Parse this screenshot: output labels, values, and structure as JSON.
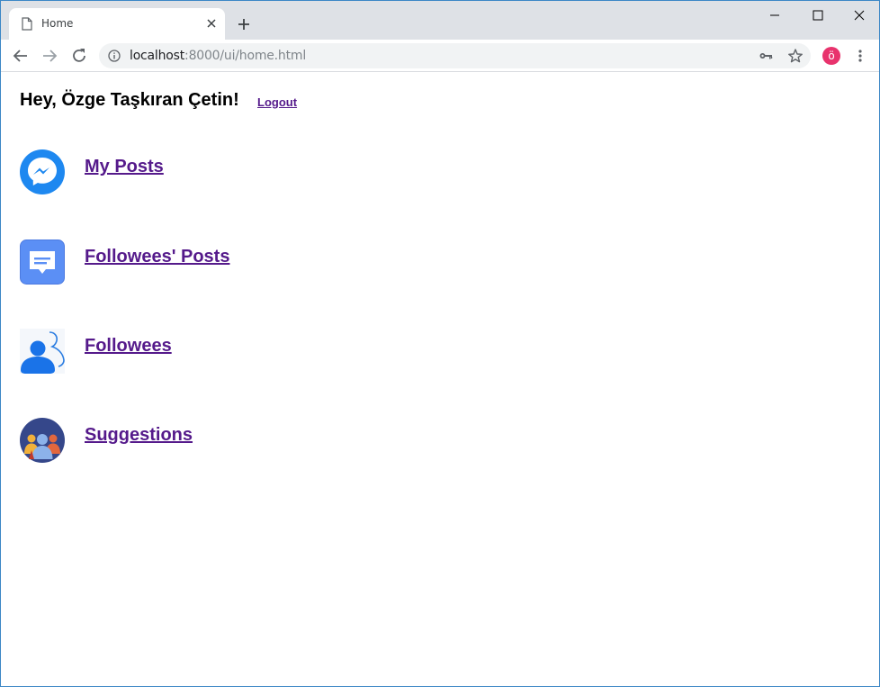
{
  "browser": {
    "tab_title": "Home",
    "url_host": "localhost",
    "url_path": ":8000/ui/home.html",
    "profile_initial": "ö"
  },
  "page": {
    "greeting": "Hey, Özge Taşkıran Çetin!",
    "logout_label": "Logout",
    "menu": [
      {
        "label": "My Posts",
        "icon": "messenger-icon"
      },
      {
        "label": "Followees' Posts",
        "icon": "chat-message-icon"
      },
      {
        "label": "Followees",
        "icon": "users-icon"
      },
      {
        "label": "Suggestions",
        "icon": "group-suggestions-icon"
      }
    ]
  },
  "colors": {
    "link_visited": "#551a8b",
    "tabstrip_bg": "#dee1e6",
    "avatar_bg": "#e8336d"
  }
}
